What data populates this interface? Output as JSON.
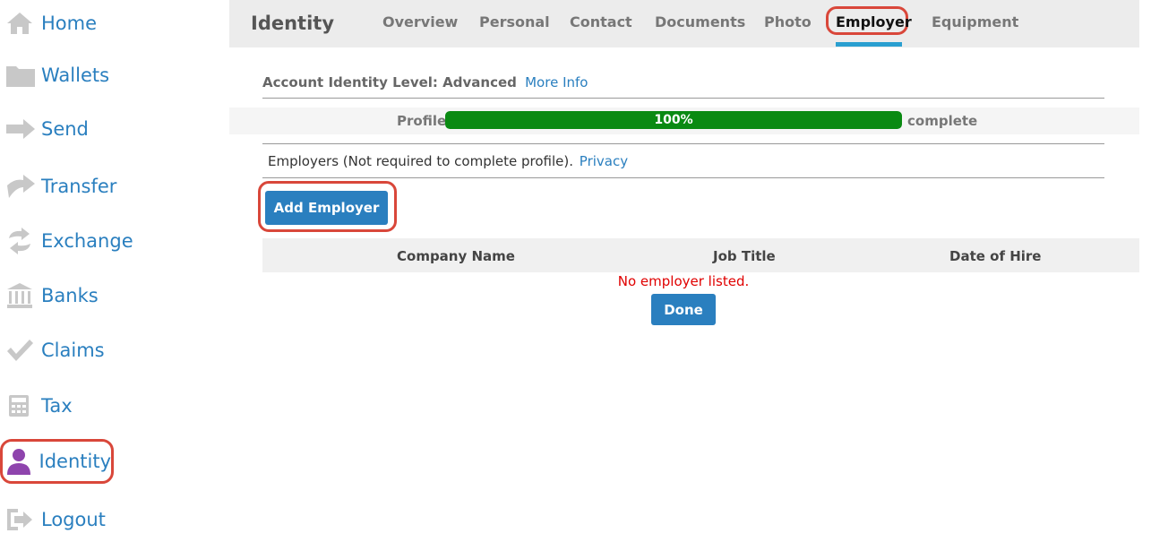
{
  "sidebar": {
    "items": [
      {
        "label": "Home",
        "icon": "home-icon"
      },
      {
        "label": "Wallets",
        "icon": "folder-icon"
      },
      {
        "label": "Send",
        "icon": "arrow-right-icon"
      },
      {
        "label": "Transfer",
        "icon": "transfer-arrow-icon"
      },
      {
        "label": "Exchange",
        "icon": "exchange-icon"
      },
      {
        "label": "Banks",
        "icon": "bank-icon"
      },
      {
        "label": "Claims",
        "icon": "checkmark-icon"
      },
      {
        "label": "Tax",
        "icon": "calculator-icon"
      },
      {
        "label": "Identity",
        "icon": "person-icon"
      },
      {
        "label": "Logout",
        "icon": "logout-icon"
      }
    ]
  },
  "topbar": {
    "title": "Identity",
    "tabs": [
      "Overview",
      "Personal",
      "Contact",
      "Documents",
      "Photo",
      "Employer",
      "Equipment"
    ],
    "active_tab": "Employer"
  },
  "identity_level": {
    "text": "Account Identity Level: Advanced",
    "link": "More Info"
  },
  "profile": {
    "label": "Profile",
    "percent_text": "100%",
    "percent_value": 100,
    "after": "complete"
  },
  "employers": {
    "note": "Employers (Not required to complete profile).",
    "privacy_link": "Privacy",
    "add_button": "Add Employer",
    "columns": [
      "Company Name",
      "Job Title",
      "Date of Hire"
    ],
    "empty_message": "No employer listed.",
    "done_button": "Done"
  },
  "colors": {
    "link_blue": "#2a7fbf",
    "progress_green": "#0a8a12",
    "highlight_red": "#d9473a",
    "identity_purple": "#8e44ad"
  }
}
